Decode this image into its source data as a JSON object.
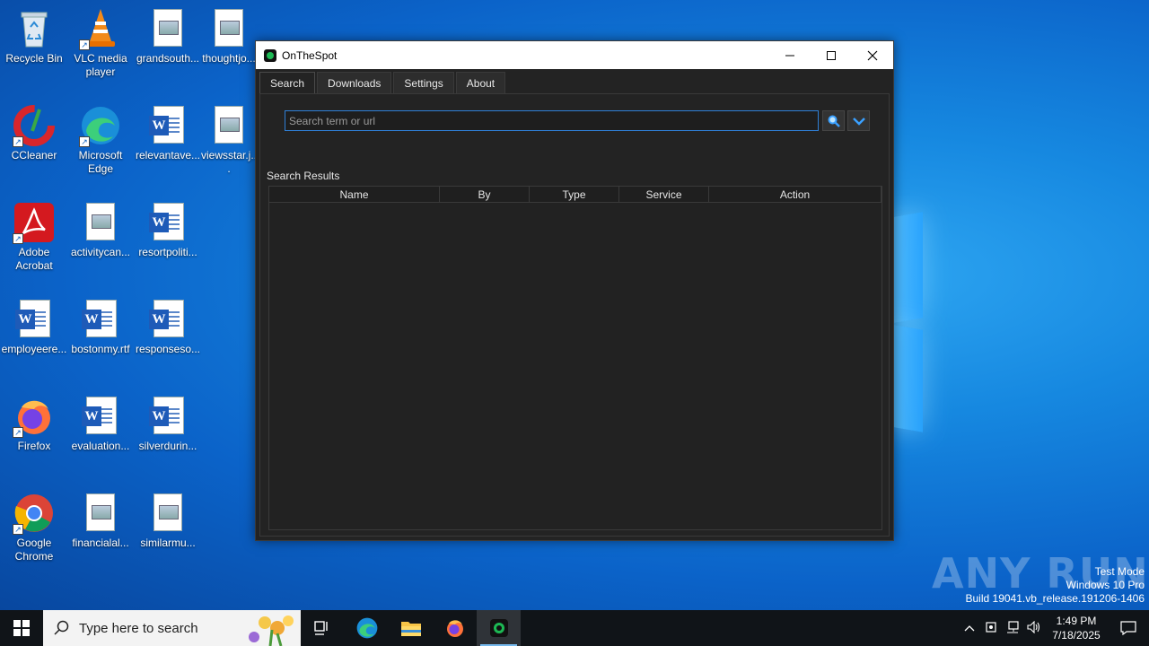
{
  "desktop": {
    "icons": [
      {
        "label": "Recycle Bin"
      },
      {
        "label": "VLC media player"
      },
      {
        "label": "grandsouth..."
      },
      {
        "label": "thoughtjo..."
      },
      {
        "label": "CCleaner"
      },
      {
        "label": "Microsoft Edge"
      },
      {
        "label": "relevantave..."
      },
      {
        "label": "viewsstar.j..."
      },
      {
        "label": "Adobe Acrobat"
      },
      {
        "label": "activitycan..."
      },
      {
        "label": "resortpoliti..."
      },
      {
        "label": "employeere..."
      },
      {
        "label": "bostonmy.rtf"
      },
      {
        "label": "responseso..."
      },
      {
        "label": "Firefox"
      },
      {
        "label": "evaluation..."
      },
      {
        "label": "silverdurin..."
      },
      {
        "label": "Google Chrome"
      },
      {
        "label": "financialal..."
      },
      {
        "label": "similarmu..."
      }
    ]
  },
  "window": {
    "title": "OnTheSpot",
    "tabs": [
      {
        "label": "Search"
      },
      {
        "label": "Downloads"
      },
      {
        "label": "Settings"
      },
      {
        "label": "About"
      }
    ],
    "search": {
      "placeholder": "Search term or url",
      "value": ""
    },
    "results_label": "Search Results",
    "table": {
      "columns": [
        "Name",
        "By",
        "Type",
        "Service",
        "Action"
      ],
      "rows": []
    }
  },
  "watermark": {
    "brand": "ANY RUN",
    "line1": "Test Mode",
    "line2": "Windows 10 Pro",
    "line3": "Build 19041.vb_release.191206-1406"
  },
  "taskbar": {
    "search_placeholder": "Type here to search",
    "time": "1:49 PM",
    "date": "7/18/2025"
  },
  "colors": {
    "accent": "#2f7fd6",
    "window_bg": "#232323",
    "taskbar_bg": "#101418"
  }
}
